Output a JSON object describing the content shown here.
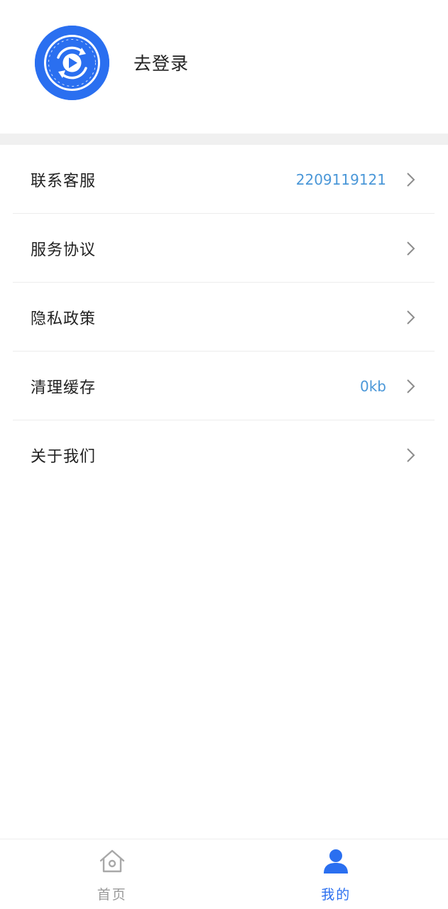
{
  "profile": {
    "login_label": "去登录"
  },
  "menu": {
    "items": [
      {
        "label": "联系客服",
        "value": "2209119121"
      },
      {
        "label": "服务协议",
        "value": ""
      },
      {
        "label": "隐私政策",
        "value": ""
      },
      {
        "label": "清理缓存",
        "value": "0kb"
      },
      {
        "label": "关于我们",
        "value": ""
      }
    ]
  },
  "tabbar": {
    "tabs": [
      {
        "label": "首页",
        "icon": "home-icon",
        "active": false
      },
      {
        "label": "我的",
        "icon": "person-icon",
        "active": true
      }
    ]
  },
  "colors": {
    "accent": "#2a6ff0",
    "value_text": "#4a97d8",
    "inactive": "#9a9a9a",
    "band": "#f0f0f0"
  }
}
